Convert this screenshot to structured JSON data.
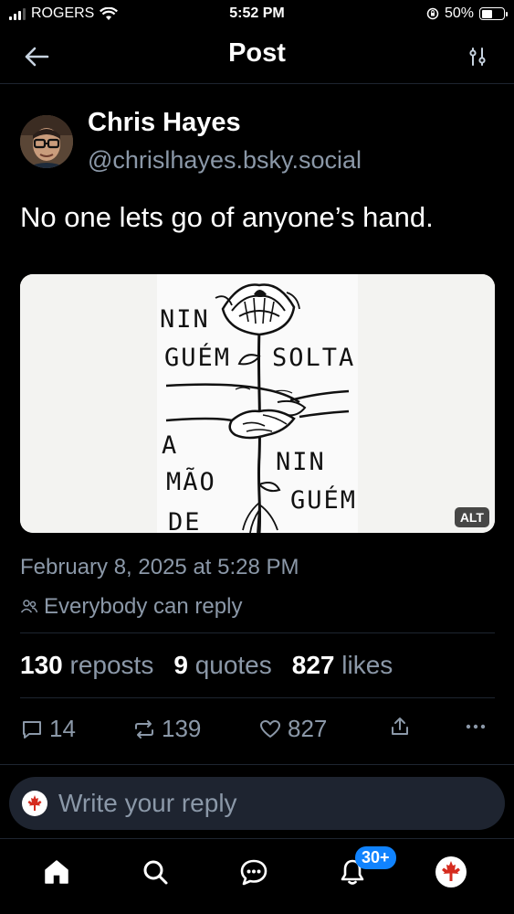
{
  "status_bar": {
    "carrier": "ROGERS",
    "time": "5:52 PM",
    "battery": "50%",
    "battery_level": 0.5
  },
  "header": {
    "title": "Post",
    "back_icon": "arrow-left-icon",
    "filter_icon": "sliders-icon"
  },
  "post": {
    "author_name": "Chris Hayes",
    "author_handle": "@chrislhayes.bsky.social",
    "text": "No one lets go of anyone’s hand.",
    "image": {
      "alt_badge": "ALT",
      "lines": [
        "NIN",
        "GUÉM",
        "SOLTA",
        "A",
        "MÃO",
        "DE",
        "NIN",
        "GUÉM"
      ]
    },
    "date": "February 8, 2025 at 5:28 PM",
    "reply_permission": "Everybody can reply"
  },
  "stats": {
    "reposts_count": "130",
    "reposts_label": "reposts",
    "quotes_count": "9",
    "quotes_label": "quotes",
    "likes_count": "827",
    "likes_label": "likes"
  },
  "actions": {
    "replies": "14",
    "reposts": "139",
    "likes": "827"
  },
  "reply_box": {
    "placeholder": "Write your reply"
  },
  "nav": {
    "notifications_badge": "30+"
  },
  "colors": {
    "background": "#000000",
    "muted": "#8b98a8",
    "accent": "#1083fe",
    "separator": "#1e2530"
  }
}
